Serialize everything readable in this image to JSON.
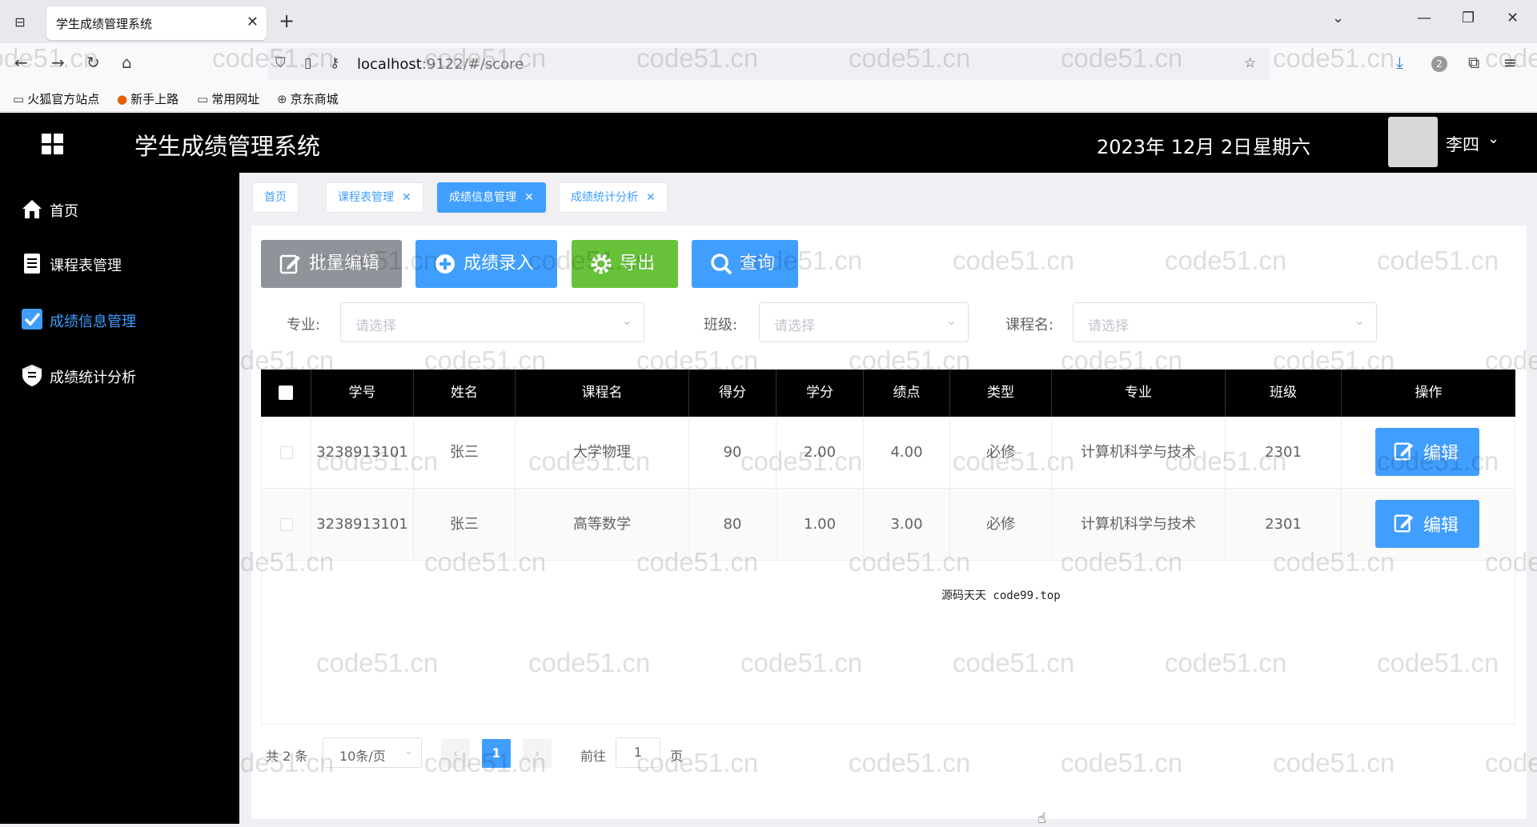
{
  "browser": {
    "tab_title": "学生成绩管理系统",
    "url_host": "localhost",
    "url_rest": ":9122/#/score",
    "bookmarks": [
      "火狐官方站点",
      "新手上路",
      "常用网址",
      "京东商城"
    ],
    "download_badge": "2"
  },
  "header": {
    "title": "学生成绩管理系统",
    "date": "2023年 12月 2日",
    "weekday": "星期六",
    "username": "李四"
  },
  "sidebar": {
    "items": [
      {
        "label": "首页",
        "icon": "home-icon"
      },
      {
        "label": "课程表管理",
        "icon": "document-icon"
      },
      {
        "label": "成绩信息管理",
        "icon": "checkbox-icon",
        "active": true
      },
      {
        "label": "成绩统计分析",
        "icon": "shield-icon"
      }
    ]
  },
  "page_tabs": [
    {
      "label": "首页",
      "closable": false
    },
    {
      "label": "课程表管理",
      "closable": true
    },
    {
      "label": "成绩信息管理",
      "closable": true,
      "active": true
    },
    {
      "label": "成绩统计分析",
      "closable": true
    }
  ],
  "toolbar": {
    "batch_edit": "批量编辑",
    "add_score": "成绩录入",
    "export": "导出",
    "query": "查询"
  },
  "filters": {
    "major_label": "专业:",
    "class_label": "班级:",
    "course_label": "课程名:",
    "placeholder": "请选择"
  },
  "table": {
    "columns": [
      "学号",
      "姓名",
      "课程名",
      "得分",
      "学分",
      "绩点",
      "类型",
      "专业",
      "班级",
      "操作"
    ],
    "rows": [
      [
        "3238913101",
        "张三",
        "大学物理",
        "90",
        "2.00",
        "4.00",
        "必修",
        "计算机科学与技术",
        "2301"
      ],
      [
        "3238913101",
        "张三",
        "高等数学",
        "80",
        "1.00",
        "3.00",
        "必修",
        "计算机科学与技术",
        "2301"
      ]
    ],
    "edit_label": "编辑"
  },
  "pagination": {
    "total": "共 2 条",
    "page_size": "10条/页",
    "current_page": "1",
    "goto_prefix": "前往",
    "goto_value": "1",
    "goto_suffix": "页"
  },
  "overlay_text": "源码天天 code99.top",
  "watermark": "code51.cn",
  "colors": {
    "accent": "#409eff",
    "gray_btn": "#909399",
    "green_btn": "#67c23a",
    "header_bg": "#000000"
  }
}
